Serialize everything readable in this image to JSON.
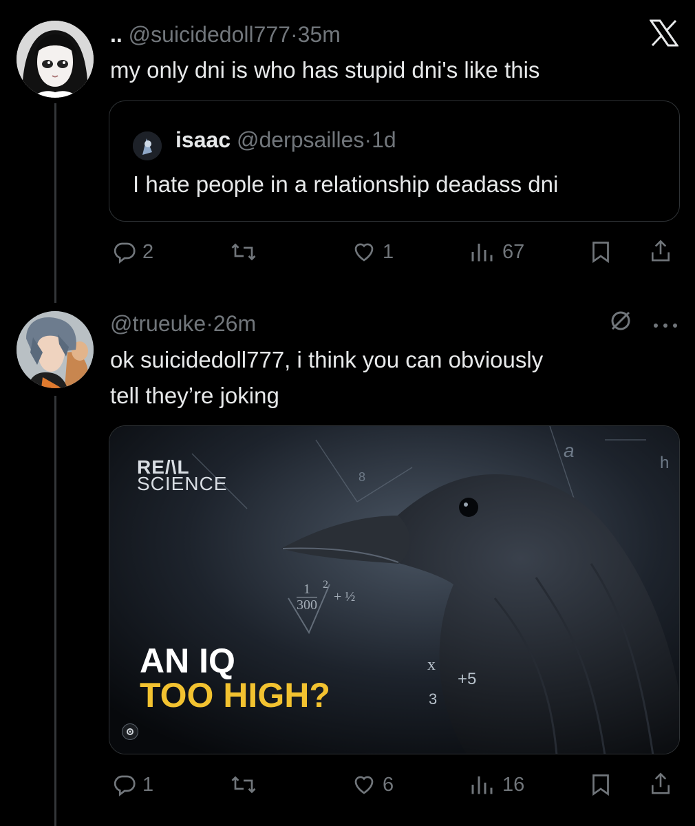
{
  "post1": {
    "name": "..",
    "handle": "@suicidedoll777",
    "sep": "·",
    "time": "35m",
    "text": "my only dni is who has stupid dni's like this",
    "quote": {
      "name": "isaac",
      "handle": "@derpsailles",
      "sep": "·",
      "time": "1d",
      "text": "I hate people in a relationship deadass dni"
    },
    "actions": {
      "replies": "2",
      "likes": "1",
      "views": "67"
    }
  },
  "post2": {
    "handle": "@trueuke",
    "sep": "·",
    "time": "26m",
    "text_line1": "ok suicidedoll777, i think you can obviously",
    "text_line2": "tell they’re joking",
    "media": {
      "brand_line1": "RE/\\L",
      "brand_line2": "SCIENCE",
      "headline_line1": "AN IQ",
      "headline_line2": "TOO HIGH?",
      "math": {
        "frac_num": "1",
        "frac_den": "300",
        "exp": "2",
        "plus_half": "+ ½",
        "x": "x",
        "plus5": "+5",
        "three": "3",
        "a": "a",
        "h": "h",
        "eight": "8"
      }
    },
    "actions": {
      "replies": "1",
      "likes": "6",
      "views": "16"
    }
  },
  "colors": {
    "background": "#000000",
    "text": "#e7e9ea",
    "muted": "#71767b",
    "border": "#2f3336",
    "headline_yellow": "#f2c230"
  },
  "icons": [
    "x-logo-icon",
    "reply-icon",
    "retweet-icon",
    "like-icon",
    "views-icon",
    "bookmark-icon",
    "share-icon",
    "mute-icon",
    "more-icon"
  ]
}
